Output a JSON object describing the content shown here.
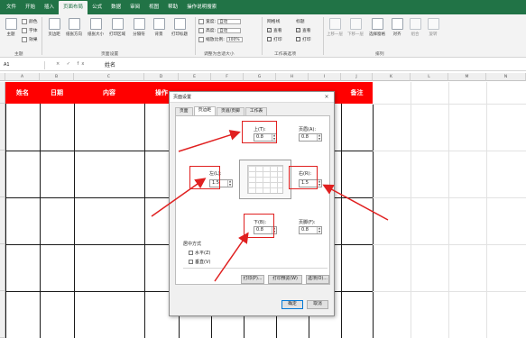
{
  "ribbon_tabs": [
    "文件",
    "开始",
    "插入",
    "页面布局",
    "公式",
    "数据",
    "审阅",
    "视图",
    "帮助",
    "操作说明搜索"
  ],
  "active_tab": "页面布局",
  "ribbon": {
    "theme_label": "主题",
    "colors_label": "颜色",
    "fonts_label": "字体",
    "effects_label": "效果",
    "theme_group": "主题",
    "btn_margins": "页边距",
    "btn_orientation": "纸张方向",
    "btn_size": "纸张大小",
    "btn_print_area": "打印区域",
    "btn_breaks": "分隔符",
    "btn_background": "背景",
    "btn_print_titles": "打印标题",
    "page_setup_group": "页面设置",
    "width_label": "宽度:",
    "width_value": "自动",
    "height_label": "高度:",
    "height_value": "自动",
    "scale_label": "缩放比例:",
    "scale_value": "100%",
    "scale_group": "调整为合适大小",
    "gridlines_label": "网格线",
    "headings_label": "标题",
    "view_label1": "查看",
    "print_label1": "打印",
    "view_label2": "查看",
    "print_label2": "打印",
    "sheet_options_group": "工作表选项",
    "btn_bring_forward": "上移一层",
    "btn_send_backward": "下移一层",
    "btn_selection_pane": "选择窗格",
    "btn_align": "对齐",
    "btn_group": "组合",
    "btn_rotate": "旋转",
    "arrange_group": "排列"
  },
  "formula_bar": {
    "name_box": "A1",
    "fx_icons": "× ✓ fx",
    "content": "姓名"
  },
  "columns": [
    "A",
    "B",
    "C",
    "D",
    "E",
    "F",
    "G",
    "H",
    "I",
    "J",
    "K",
    "L",
    "M",
    "N"
  ],
  "header_row": [
    "姓名",
    "日期",
    "内容",
    "操作",
    "",
    "",
    "",
    "",
    "备注"
  ],
  "dialog": {
    "title": "页面设置",
    "close": "×",
    "tabs": [
      "页面",
      "页边距",
      "页眉/页脚",
      "工作表"
    ],
    "active_tab": "页边距",
    "top_label": "上(T):",
    "top_value": "0.8",
    "header_label": "页眉(A):",
    "header_value": "0.8",
    "left_label": "左(L):",
    "left_value": "1.5",
    "right_label": "右(R):",
    "right_value": "1.5",
    "bottom_label": "下(B):",
    "bottom_value": "0.8",
    "footer_label": "页脚(F):",
    "footer_value": "0.8",
    "center_label": "居中方式",
    "horizontal_label": "水平(Z)",
    "vertical_label": "垂直(V)",
    "btn_print": "打印(P)...",
    "btn_preview": "打印预览(W)",
    "btn_options": "选项(O)...",
    "btn_ok": "确定",
    "btn_cancel": "取消"
  },
  "colors": {
    "excel_green": "#217346",
    "header_red": "#ff0000",
    "annotation_red": "#e02020"
  }
}
